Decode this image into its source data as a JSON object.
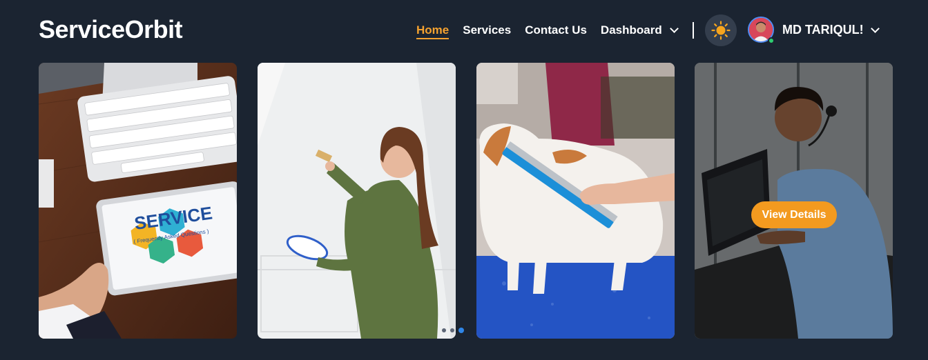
{
  "brand": "ServiceOrbit",
  "nav": {
    "items": [
      {
        "label": "Home",
        "active": true
      },
      {
        "label": "Services"
      },
      {
        "label": "Contact Us"
      }
    ],
    "dashboard_label": "Dashboard"
  },
  "user": {
    "name": "MD TARIQUL!",
    "status": "online"
  },
  "colors": {
    "accent": "#f5a230",
    "background": "#1b2431",
    "button": "#f39a1f",
    "active_dot": "#2f86e8"
  },
  "cards": [
    {
      "image": "service-desk-photo",
      "sign_text": "SERVICE",
      "sign_subtitle": "( Frequently Asked Questions )"
    },
    {
      "image": "woman-painting-wall-photo"
    },
    {
      "image": "dog-grooming-photo"
    },
    {
      "image": "call-center-agent-photo",
      "button_label": "View Details"
    }
  ],
  "carousel": {
    "active_index": 1
  }
}
